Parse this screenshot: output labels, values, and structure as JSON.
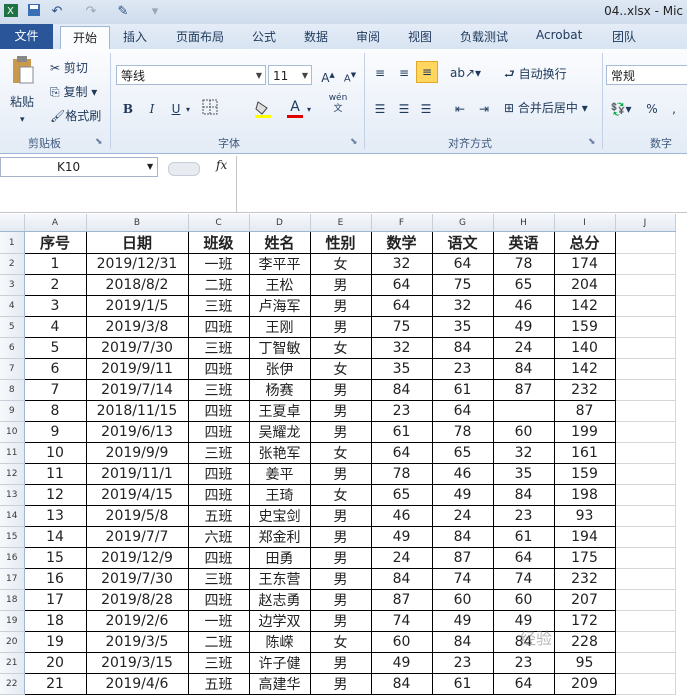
{
  "window": {
    "title": "04..xlsx - Mic"
  },
  "quick_access": [
    "save-icon",
    "undo-icon",
    "redo-icon",
    "brush-icon",
    "customize-icon"
  ],
  "tabs": [
    "文件",
    "开始",
    "插入",
    "页面布局",
    "公式",
    "数据",
    "审阅",
    "视图",
    "负载测试",
    "Acrobat",
    "团队"
  ],
  "ribbon": {
    "clipboard": {
      "paste": "粘贴",
      "cut": "剪切",
      "copy": "复制",
      "format_painter": "格式刷",
      "label": "剪贴板"
    },
    "font": {
      "name": "等线",
      "size": "11",
      "label": "字体",
      "bold": "B",
      "italic": "I",
      "underline": "U",
      "wen": "wén\n文"
    },
    "alignment": {
      "wrap": "自动换行",
      "merge": "合并后居中",
      "label": "对齐方式"
    },
    "number": {
      "format": "常规",
      "percent": "%",
      "label": "数字"
    }
  },
  "formula_bar": {
    "name_box": "K10",
    "fx": "fx",
    "value": ""
  },
  "columns": [
    "A",
    "B",
    "C",
    "D",
    "E",
    "F",
    "G",
    "H",
    "I",
    "J"
  ],
  "header_row": [
    "序号",
    "日期",
    "班级",
    "姓名",
    "性别",
    "数学",
    "语文",
    "英语",
    "总分"
  ],
  "rows": [
    [
      "1",
      "2019/12/31",
      "一班",
      "李平平",
      "女",
      "32",
      "64",
      "78",
      "174"
    ],
    [
      "2",
      "2018/8/2",
      "二班",
      "王松",
      "男",
      "64",
      "75",
      "65",
      "204"
    ],
    [
      "3",
      "2019/1/5",
      "三班",
      "卢海军",
      "男",
      "64",
      "32",
      "46",
      "142"
    ],
    [
      "4",
      "2019/3/8",
      "四班",
      "王刚",
      "男",
      "75",
      "35",
      "49",
      "159"
    ],
    [
      "5",
      "2019/7/30",
      "三班",
      "丁智敏",
      "女",
      "32",
      "84",
      "24",
      "140"
    ],
    [
      "6",
      "2019/9/11",
      "四班",
      "张伊",
      "女",
      "35",
      "23",
      "84",
      "142"
    ],
    [
      "7",
      "2019/7/14",
      "三班",
      "杨赛",
      "男",
      "84",
      "61",
      "87",
      "232"
    ],
    [
      "8",
      "2018/11/15",
      "四班",
      "王夏卓",
      "男",
      "23",
      "64",
      "",
      "87"
    ],
    [
      "9",
      "2019/6/13",
      "四班",
      "吴耀龙",
      "男",
      "61",
      "78",
      "60",
      "199"
    ],
    [
      "10",
      "2019/9/9",
      "三班",
      "张艳军",
      "女",
      "64",
      "65",
      "32",
      "161"
    ],
    [
      "11",
      "2019/11/1",
      "四班",
      "姜平",
      "男",
      "78",
      "46",
      "35",
      "159"
    ],
    [
      "12",
      "2019/4/15",
      "四班",
      "王琦",
      "女",
      "65",
      "49",
      "84",
      "198"
    ],
    [
      "13",
      "2019/5/8",
      "五班",
      "史宝剑",
      "男",
      "46",
      "24",
      "23",
      "93"
    ],
    [
      "14",
      "2019/7/7",
      "六班",
      "郑金利",
      "男",
      "49",
      "84",
      "61",
      "194"
    ],
    [
      "15",
      "2019/12/9",
      "四班",
      "田勇",
      "男",
      "24",
      "87",
      "64",
      "175"
    ],
    [
      "16",
      "2019/7/30",
      "三班",
      "王东营",
      "男",
      "84",
      "74",
      "74",
      "232"
    ],
    [
      "17",
      "2019/8/28",
      "四班",
      "赵志勇",
      "男",
      "87",
      "60",
      "60",
      "207"
    ],
    [
      "18",
      "2019/2/6",
      "一班",
      "边学双",
      "男",
      "74",
      "49",
      "49",
      "172"
    ],
    [
      "19",
      "2019/3/5",
      "二班",
      "陈嵘",
      "女",
      "60",
      "84",
      "84",
      "228"
    ],
    [
      "20",
      "2019/3/15",
      "三班",
      "许子健",
      "男",
      "49",
      "23",
      "23",
      "95"
    ],
    [
      "21",
      "2019/4/6",
      "五班",
      "高建华",
      "男",
      "84",
      "61",
      "64",
      "209"
    ]
  ],
  "watermark": "经验"
}
